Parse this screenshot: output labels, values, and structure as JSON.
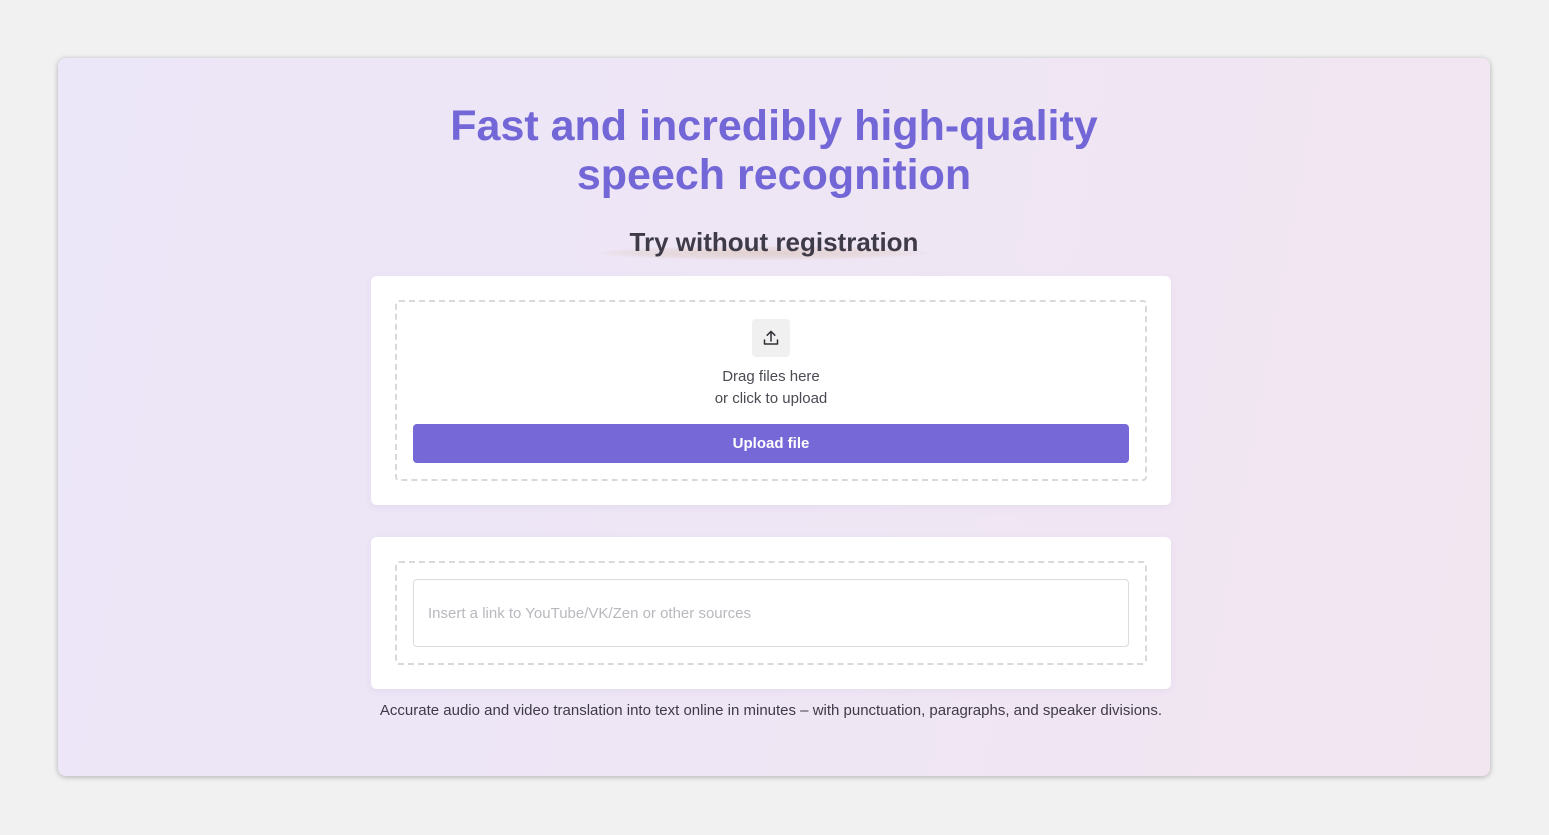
{
  "hero": {
    "title_line1": "Fast and incredibly high-quality",
    "title_line2": "speech recognition",
    "subtitle": "Try without registration"
  },
  "upload": {
    "icon": "upload-icon",
    "drag_text": "Drag files here",
    "click_text": "or click to upload",
    "button_label": "Upload file"
  },
  "link": {
    "value": "",
    "placeholder": "Insert a link to YouTube/VK/Zen or other sources"
  },
  "footer": {
    "description": "Accurate audio and video translation into text online in minutes – with punctuation, paragraphs, and speaker divisions."
  },
  "colors": {
    "accent": "#7366d6",
    "button": "#7668d6",
    "page_background": "#f1f1f1"
  }
}
